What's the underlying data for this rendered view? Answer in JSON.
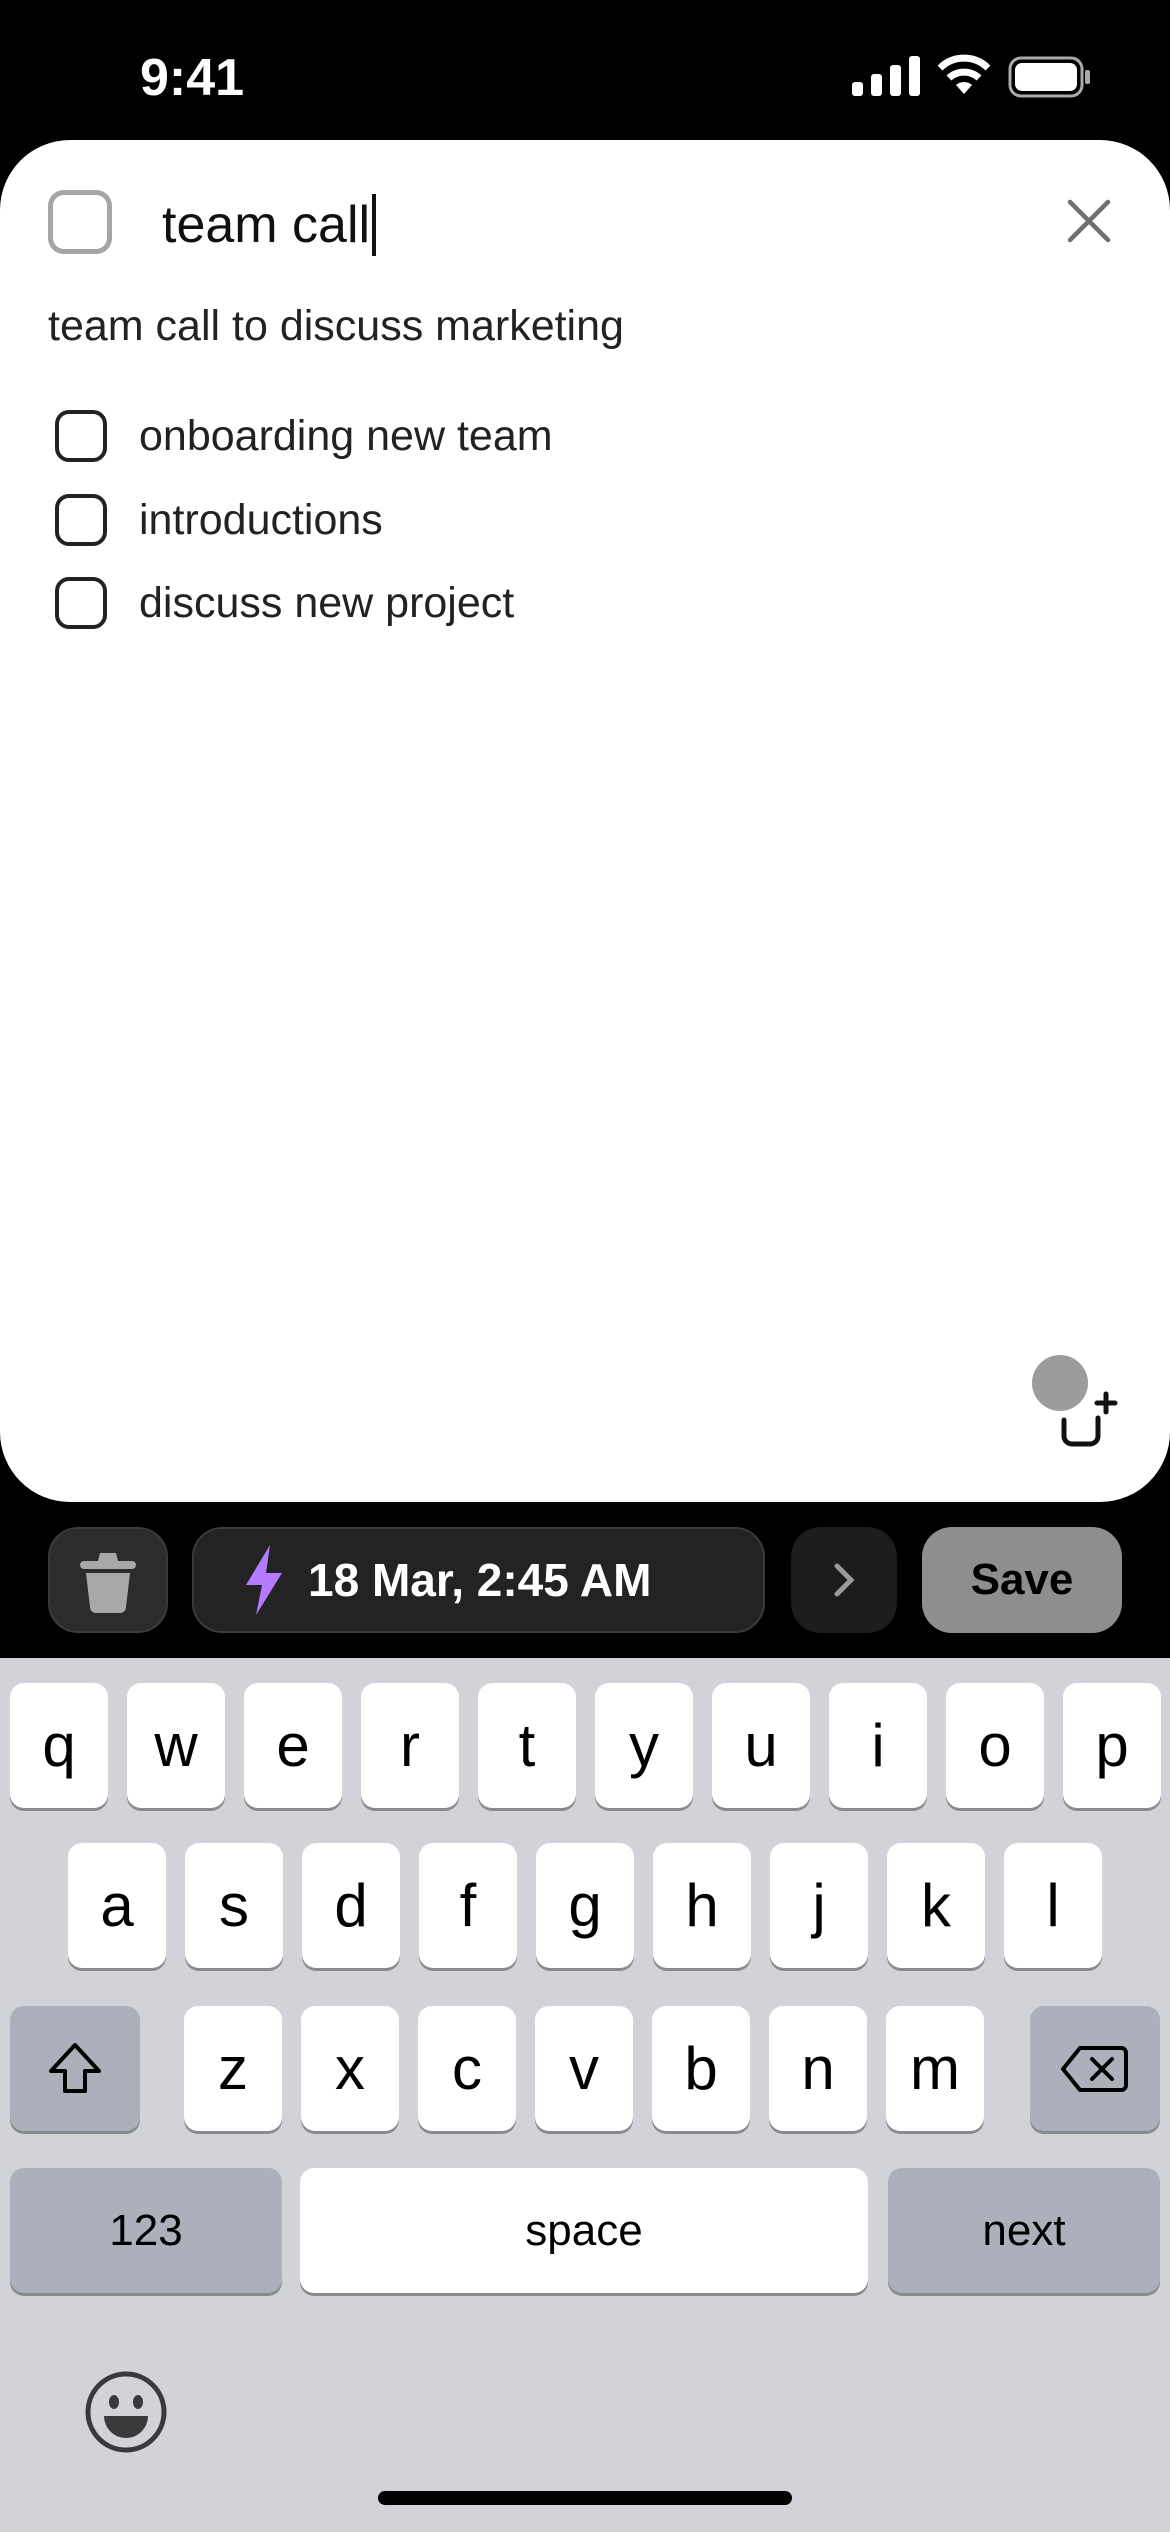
{
  "status_bar": {
    "time": "9:41"
  },
  "task": {
    "title": "team call",
    "description": "team call to discuss marketing",
    "subtasks": [
      {
        "label": "onboarding new team",
        "checked": false
      },
      {
        "label": "introductions",
        "checked": false
      },
      {
        "label": "discuss new project",
        "checked": false
      }
    ]
  },
  "toolbar": {
    "date_label": "18 Mar, 2:45 AM",
    "save_label": "Save",
    "accent": "#b57bff"
  },
  "keyboard": {
    "row1": [
      "q",
      "w",
      "e",
      "r",
      "t",
      "y",
      "u",
      "i",
      "o",
      "p"
    ],
    "row2": [
      "a",
      "s",
      "d",
      "f",
      "g",
      "h",
      "j",
      "k",
      "l"
    ],
    "row3": [
      "z",
      "x",
      "c",
      "v",
      "b",
      "n",
      "m"
    ],
    "numbers_label": "123",
    "space_label": "space",
    "next_label": "next"
  }
}
